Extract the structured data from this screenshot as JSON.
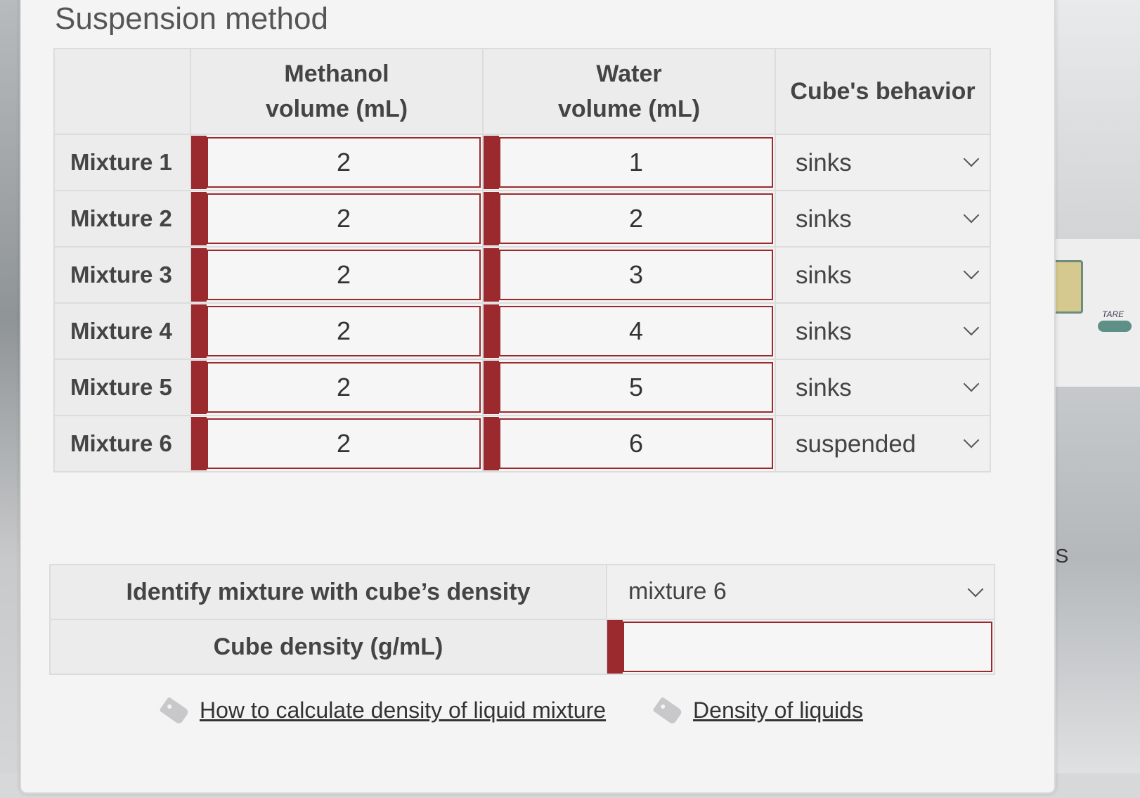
{
  "title": "Suspension method",
  "table": {
    "headers": [
      "",
      "Methanol\nvolume (mL)",
      "Water\nvolume (mL)",
      "Cube's behavior"
    ],
    "header_lines": {
      "methanol": [
        "Methanol",
        "volume (mL)"
      ],
      "water": [
        "Water",
        "volume (mL)"
      ],
      "behavior": "Cube's behavior"
    },
    "rows": [
      {
        "label": "Mixture 1",
        "methanol": "2",
        "water": "1",
        "behavior": "sinks"
      },
      {
        "label": "Mixture 2",
        "methanol": "2",
        "water": "2",
        "behavior": "sinks"
      },
      {
        "label": "Mixture 3",
        "methanol": "2",
        "water": "3",
        "behavior": "sinks"
      },
      {
        "label": "Mixture 4",
        "methanol": "2",
        "water": "4",
        "behavior": "sinks"
      },
      {
        "label": "Mixture 5",
        "methanol": "2",
        "water": "5",
        "behavior": "sinks"
      },
      {
        "label": "Mixture 6",
        "methanol": "2",
        "water": "6",
        "behavior": "suspended"
      }
    ]
  },
  "identify": {
    "label": "Identify mixture with cube’s density",
    "selected": "mixture 6"
  },
  "density": {
    "label": "Cube density (g/mL)",
    "value": ""
  },
  "links": [
    {
      "label": "How to calculate density of liquid mixture",
      "icon": "tag-icon"
    },
    {
      "label": "Density of liquids",
      "icon": "tag-icon"
    }
  ],
  "background": {
    "side_text": "LS",
    "tare_label": "TARE"
  },
  "colors": {
    "accent": "#9b2a2e",
    "header_bg": "#ececed",
    "panel_bg": "#f4f4f5"
  }
}
